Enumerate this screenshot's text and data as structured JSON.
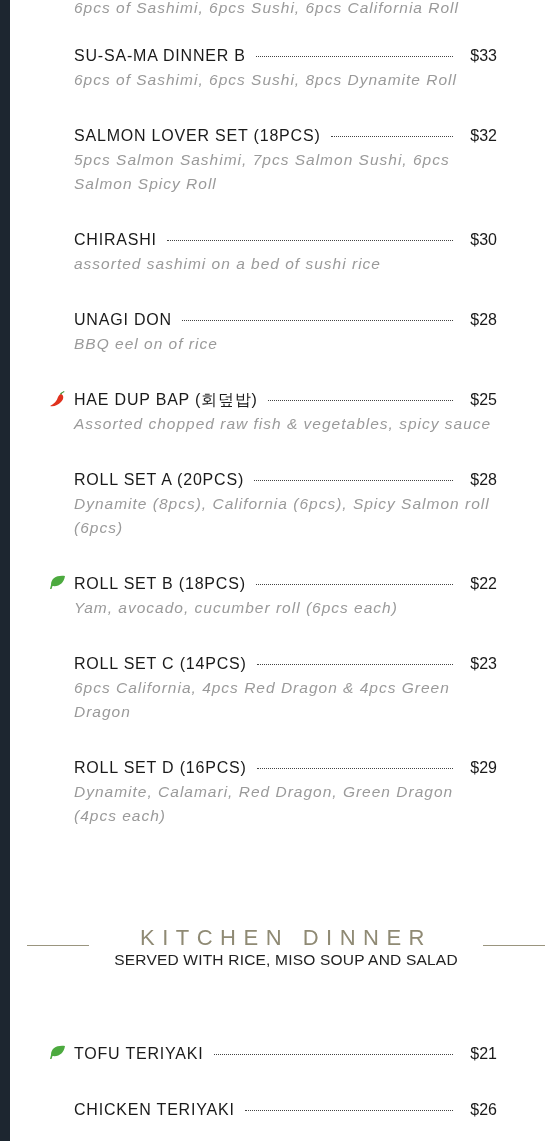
{
  "sections": [
    {
      "items": [
        {
          "description": "6pcs of Sashimi, 6pcs Sushi, 6pcs California Roll",
          "kind": "plain"
        },
        {
          "name": "SU-SA-MA DINNER B",
          "price": "$33",
          "description": "6pcs of Sashimi, 6pcs Sushi, 8pcs Dynamite Roll",
          "kind": "plain"
        },
        {
          "name": "SALMON LOVER SET (18PCS)",
          "price": "$32",
          "description": "5pcs Salmon Sashimi, 7pcs Salmon Sushi, 6pcs Salmon Spicy Roll",
          "kind": "plain"
        },
        {
          "name": "CHIRASHI",
          "price": "$30",
          "description": "assorted sashimi on a bed of sushi rice",
          "kind": "plain"
        },
        {
          "name": "UNAGI DON",
          "price": "$28",
          "description": "BBQ eel on of rice",
          "kind": "plain"
        },
        {
          "name": "HAE DUP BAP (회덮밥)",
          "price": "$25",
          "description": "Assorted chopped raw fish & vegetables, spicy sauce",
          "kind": "spicy"
        },
        {
          "name": "ROLL SET A (20PCS)",
          "price": "$28",
          "description": "Dynamite (8pcs), California (6pcs), Spicy Salmon roll (6pcs)",
          "kind": "plain"
        },
        {
          "name": "ROLL SET B (18PCS)",
          "price": "$22",
          "description": "Yam, avocado, cucumber roll (6pcs each)",
          "kind": "vegetarian"
        },
        {
          "name": "ROLL SET C (14PCS)",
          "price": "$23",
          "description": "6pcs California, 4pcs Red Dragon & 4pcs Green Dragon",
          "kind": "plain"
        },
        {
          "name": "ROLL SET D (16PCS)",
          "price": "$29",
          "description": "Dynamite, Calamari, Red Dragon, Green Dragon (4pcs each)",
          "kind": "plain"
        }
      ]
    },
    {
      "title": "KITCHEN DINNER",
      "subtitle": "SERVED WITH RICE, MISO SOUP AND SALAD",
      "items": [
        {
          "name": "TOFU TERIYAKI",
          "price": "$21",
          "kind": "vegetarian"
        },
        {
          "name": "CHICKEN TERIYAKI",
          "price": "$26",
          "kind": "plain"
        }
      ]
    }
  ]
}
